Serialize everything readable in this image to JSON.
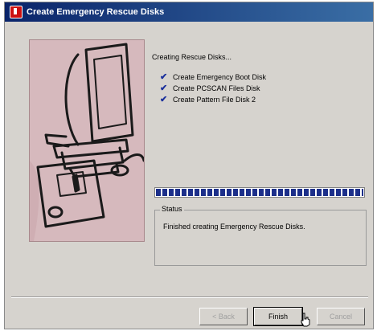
{
  "window": {
    "title": "Create Emergency Rescue Disks"
  },
  "content": {
    "heading": "Creating Rescue Disks...",
    "steps": [
      {
        "label": "Create Emergency Boot Disk",
        "done": true
      },
      {
        "label": "Create PCSCAN Files Disk",
        "done": true
      },
      {
        "label": "Create Pattern File Disk 2",
        "done": true
      }
    ],
    "progress": 1.0
  },
  "status": {
    "legend": "Status",
    "text": "Finished creating Emergency Rescue Disks."
  },
  "buttons": {
    "back": "< Back",
    "finish": "Finish",
    "cancel": "Cancel"
  },
  "colors": {
    "titlebar": "#0a246a",
    "progress": "#1c2f8a",
    "art_bg": "#d6b9bd"
  },
  "icons": {
    "title": "app-shield-icon",
    "check": "check-mark-icon",
    "illustration": "computer-and-floppy-illustration"
  }
}
